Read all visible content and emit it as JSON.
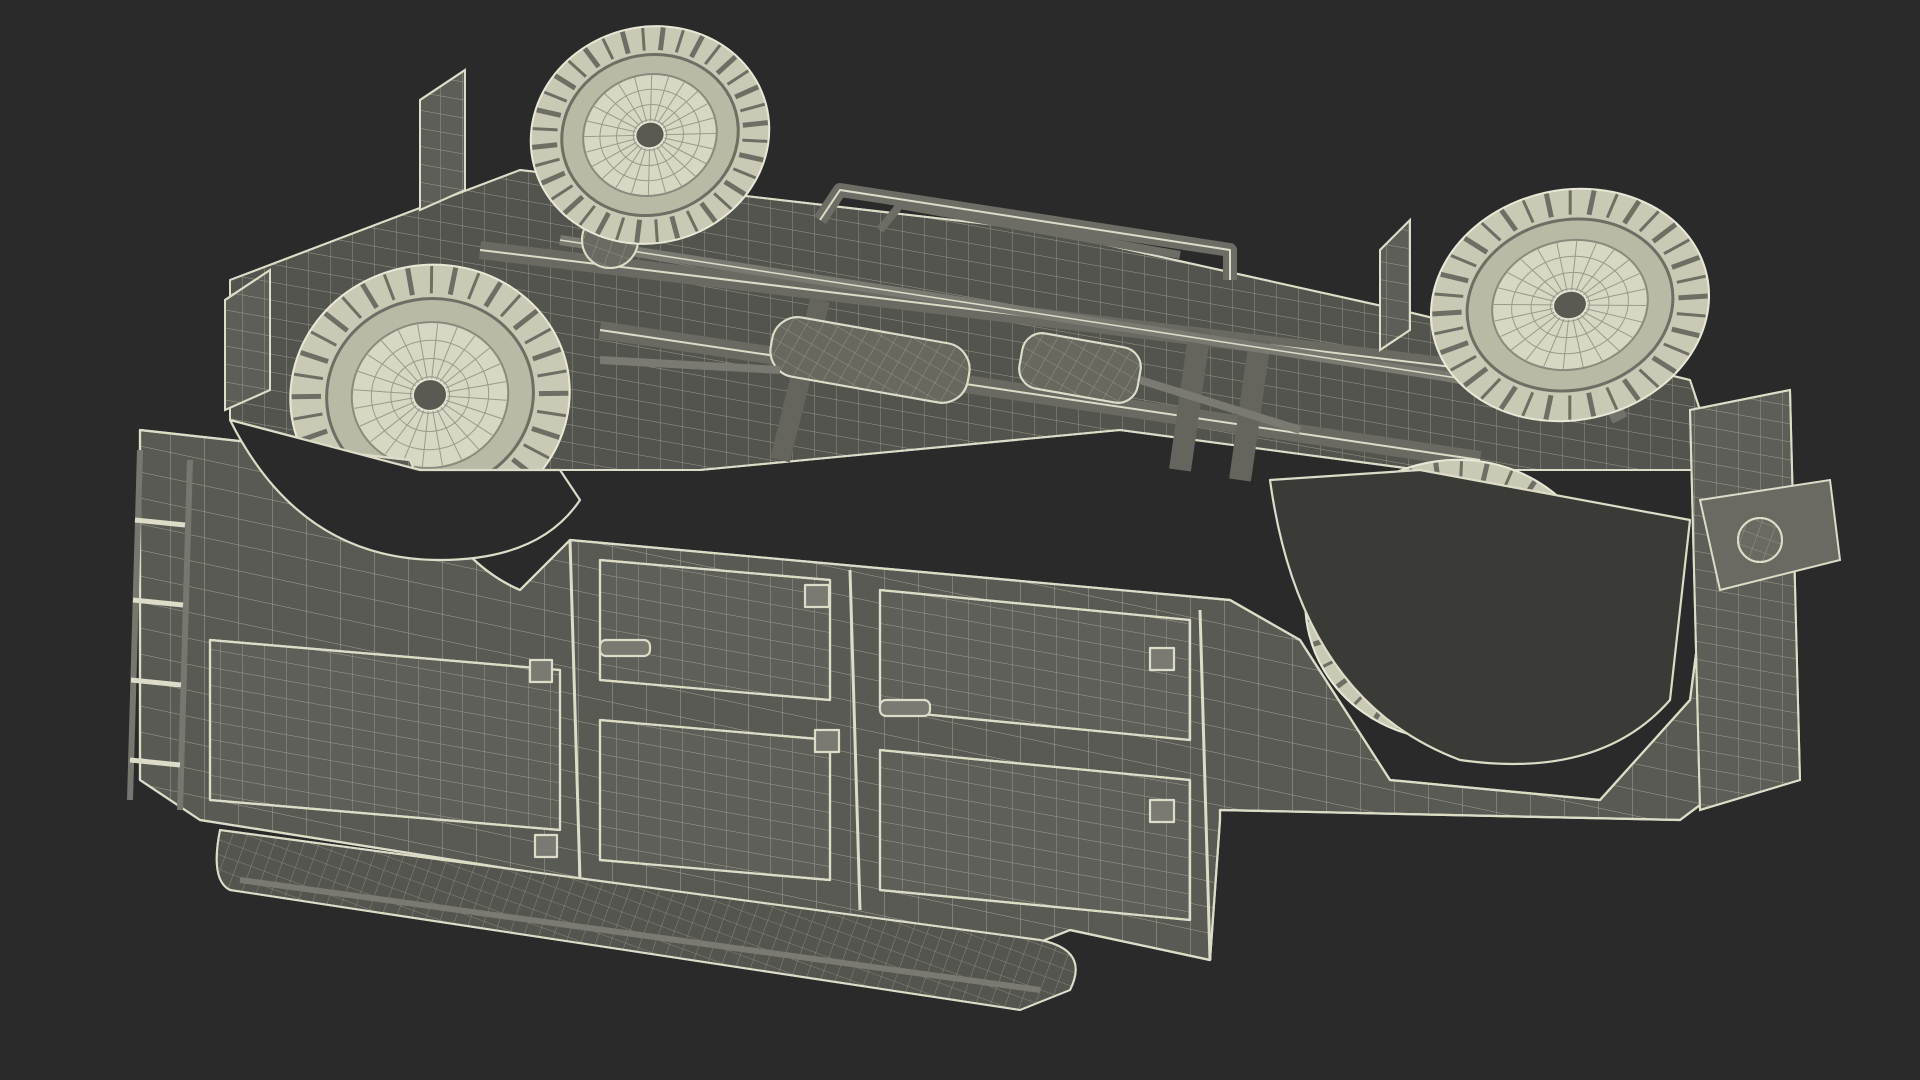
{
  "scene": {
    "subject_icon": "offroad-vehicle-underside-wireframe",
    "colors": {
      "background": "#2a2a2a",
      "surface": "#5c5c56",
      "surface_dark": "#4b4b46",
      "surface_light": "#6e6e67",
      "wire": "#dcdcc8",
      "wire_dim": "#b9b9a6"
    }
  }
}
